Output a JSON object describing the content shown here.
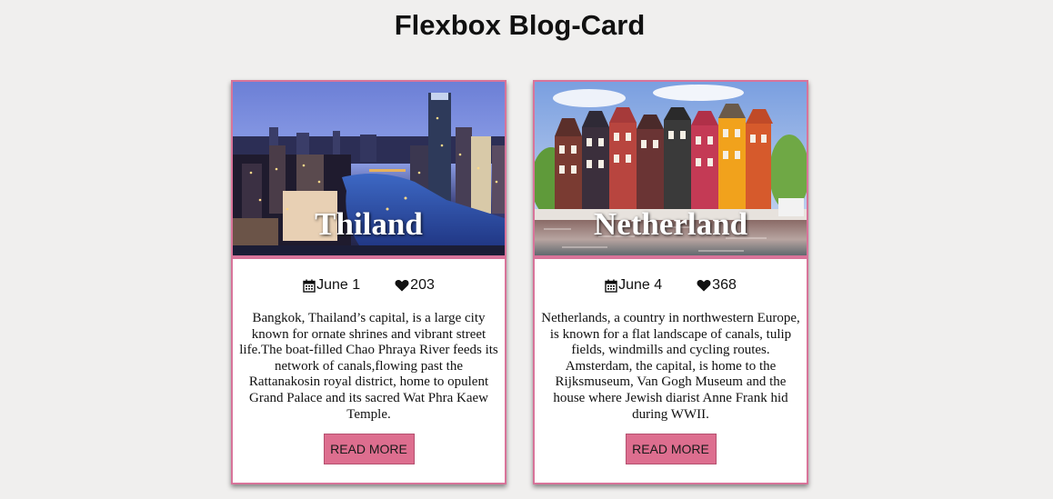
{
  "page": {
    "title": "Flexbox Blog-Card"
  },
  "colors": {
    "accent": "#d8749a",
    "button": "#dd6e8f",
    "background": "#f0efee"
  },
  "cards": [
    {
      "caption": "Thiland",
      "date_icon": "calendar-icon",
      "date": "June 1",
      "likes_icon": "heart-icon",
      "likes": "203",
      "description": "Bangkok, Thailand’s capital, is a large city known for ornate shrines and vibrant street life.The boat-filled Chao Phraya River feeds its network of canals,flowing past the Rattanakosin royal district, home to opulent Grand Palace and its sacred Wat Phra Kaew Temple.",
      "button": "READ MORE"
    },
    {
      "caption": "Netherland",
      "date_icon": "calendar-icon",
      "date": "June 4",
      "likes_icon": "heart-icon",
      "likes": "368",
      "description": "Netherlands, a country in northwestern Europe, is known for a flat landscape of canals, tulip fields, windmills and cycling routes. Amsterdam, the capital, is home to the Rijksmuseum, Van Gogh Museum and the house where Jewish diarist Anne Frank hid during WWII.",
      "button": "READ MORE"
    }
  ]
}
